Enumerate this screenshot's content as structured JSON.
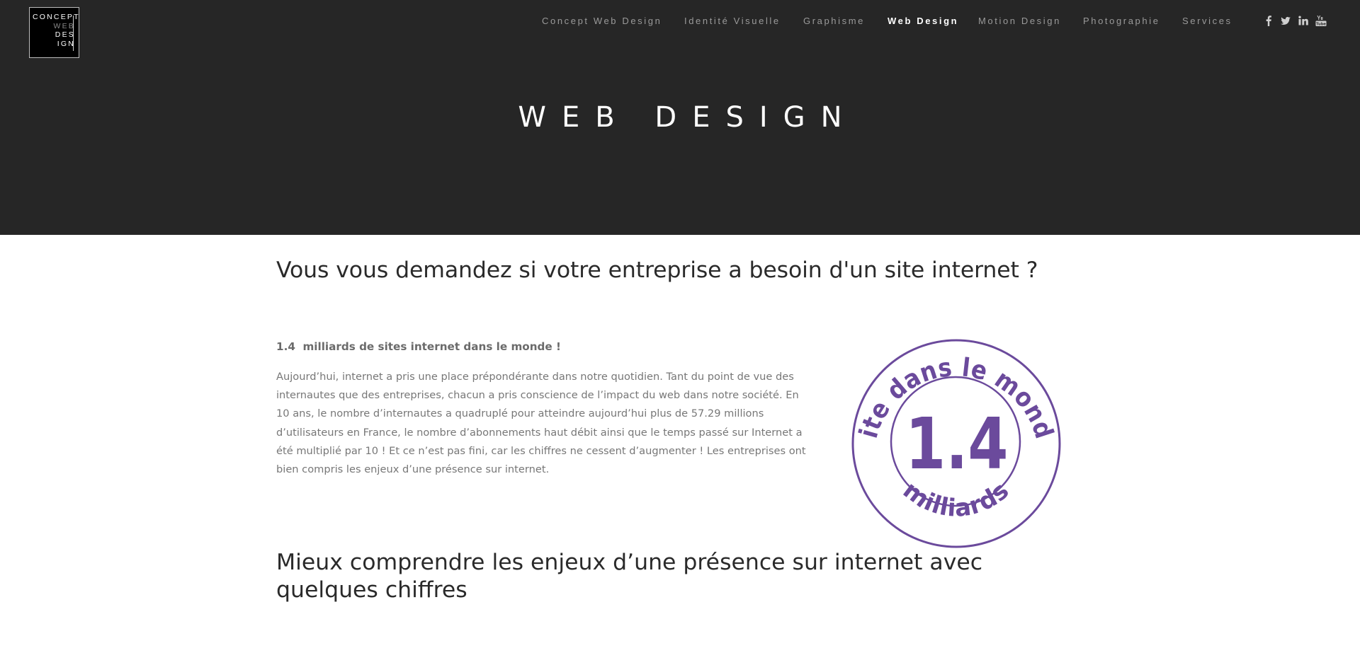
{
  "logo": {
    "lines": [
      "CONCEPT",
      "WEB",
      "DES",
      "IGN"
    ],
    "alt": "Concept Web Design logo"
  },
  "nav": {
    "items": [
      {
        "label": "Concept Web Design",
        "active": false
      },
      {
        "label": "Identité Visuelle",
        "active": false
      },
      {
        "label": "Graphisme",
        "active": false
      },
      {
        "label": "Web Design",
        "active": true
      },
      {
        "label": "Motion Design",
        "active": false
      },
      {
        "label": "Photographie",
        "active": false
      },
      {
        "label": "Services",
        "active": false
      }
    ],
    "social": [
      {
        "name": "facebook-icon"
      },
      {
        "name": "twitter-icon"
      },
      {
        "name": "linkedin-icon"
      },
      {
        "name": "youtube-icon"
      }
    ]
  },
  "hero": {
    "title": "WEB DESIGN"
  },
  "content": {
    "heading": "Vous vous demandez si votre entreprise a besoin d'un site internet ?",
    "subheading": "1.4  milliards de sites internet dans le monde !",
    "paragraph": "Aujourd’hui, internet a pris une place prépondérante dans notre quotidien. Tant du point de vue des internautes que des entreprises, chacun a pris conscience de l’impact du web dans notre société. En 10 ans, le nombre d’internautes a quadruplé pour atteindre aujourd’hui plus de 57.29 millions d’utilisateurs en France, le nombre d’abonnements haut débit ainsi que le temps passé sur Internet a été multiplié par 10 !  Et ce n’est pas fini, car les chiffres ne cessent d’augmenter ! Les entreprises ont bien compris les enjeux d’une présence sur internet.",
    "heading2": "Mieux comprendre les enjeux d’une présence sur internet avec quelques chiffres"
  },
  "stamp": {
    "top_text": "Site dans le monde",
    "number": "1.4",
    "bottom_text": "milliards",
    "color": "#6b4a9c"
  },
  "colors": {
    "header_bg": "#262626",
    "nav_text": "#9a9a9a",
    "nav_active": "#ffffff",
    "heading": "#2a2a2a",
    "body_text": "#777777"
  }
}
